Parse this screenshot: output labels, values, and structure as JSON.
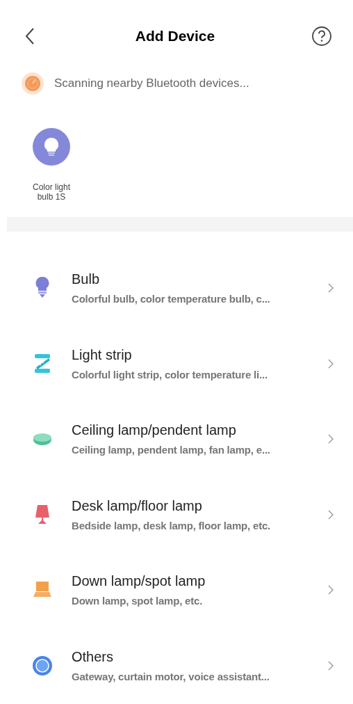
{
  "header": {
    "title": "Add Device"
  },
  "scan": {
    "text": "Scanning nearby Bluetooth devices..."
  },
  "found_devices": [
    {
      "name": "Color light bulb 1S"
    }
  ],
  "categories": [
    {
      "kind": "bulb",
      "title": "Bulb",
      "subtitle": "Colorful bulb, color temperature bulb, c..."
    },
    {
      "kind": "strip",
      "title": "Light strip",
      "subtitle": "Colorful light strip, color temperature li..."
    },
    {
      "kind": "ceiling",
      "title": "Ceiling lamp/pendent lamp",
      "subtitle": "Ceiling lamp, pendent lamp, fan lamp, e..."
    },
    {
      "kind": "desk",
      "title": "Desk lamp/floor lamp",
      "subtitle": "Bedside lamp, desk lamp, floor lamp, etc."
    },
    {
      "kind": "down",
      "title": "Down lamp/spot lamp",
      "subtitle": "Down lamp, spot lamp, etc."
    },
    {
      "kind": "others",
      "title": "Others",
      "subtitle": "Gateway, curtain motor, voice assistant..."
    }
  ]
}
